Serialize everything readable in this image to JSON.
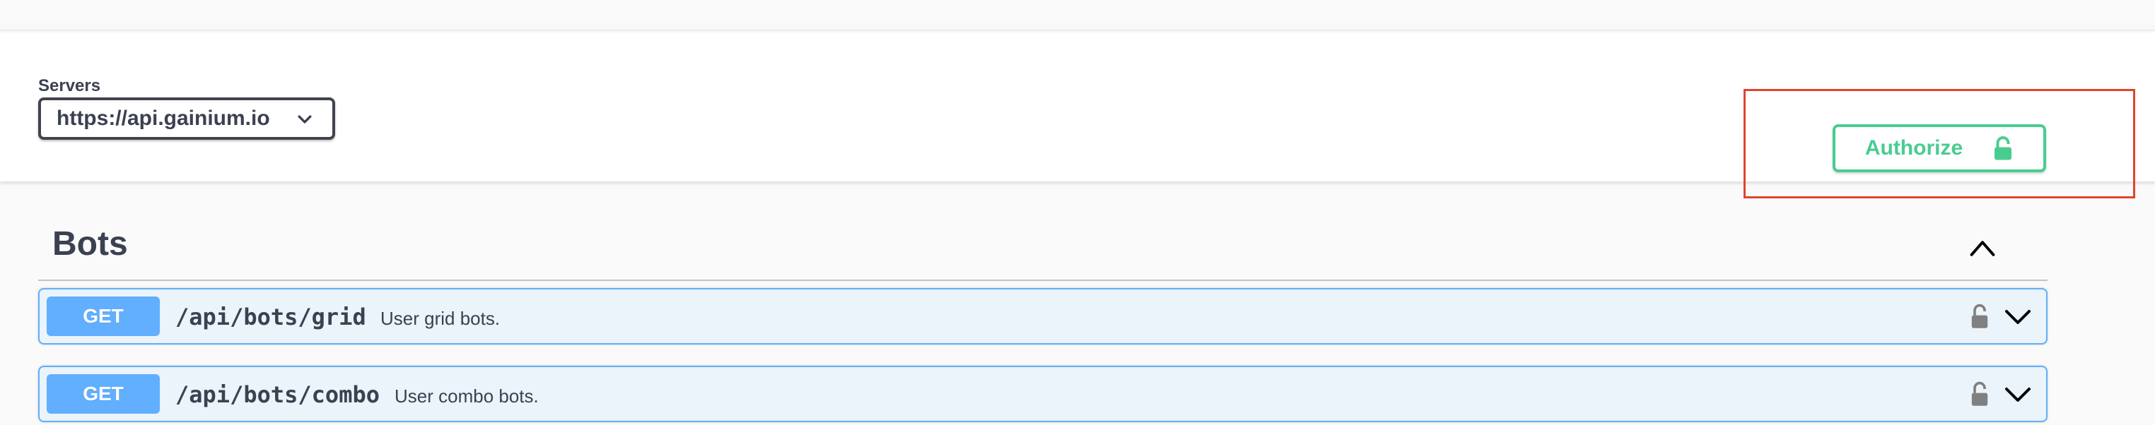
{
  "servers": {
    "label": "Servers",
    "selected": "https://api.gainium.io"
  },
  "authorize": {
    "label": "Authorize"
  },
  "tag": {
    "title": "Bots"
  },
  "operations": [
    {
      "method": "GET",
      "path": "/api/bots/grid",
      "summary": "User grid bots."
    },
    {
      "method": "GET",
      "path": "/api/bots/combo",
      "summary": "User combo bots."
    }
  ],
  "colors": {
    "get_method": "#61affe",
    "get_background": "#ebf3fb",
    "authorize_green": "#49cc90",
    "highlight_red": "#e0442c",
    "text": "#3b4151"
  },
  "icons": {
    "servers_dropdown": "chevron-down-icon",
    "authorize": "lock-open-icon",
    "tag_toggle": "chevron-up-icon",
    "operation_lock": "lock-icon",
    "operation_expand": "chevron-down-icon"
  }
}
